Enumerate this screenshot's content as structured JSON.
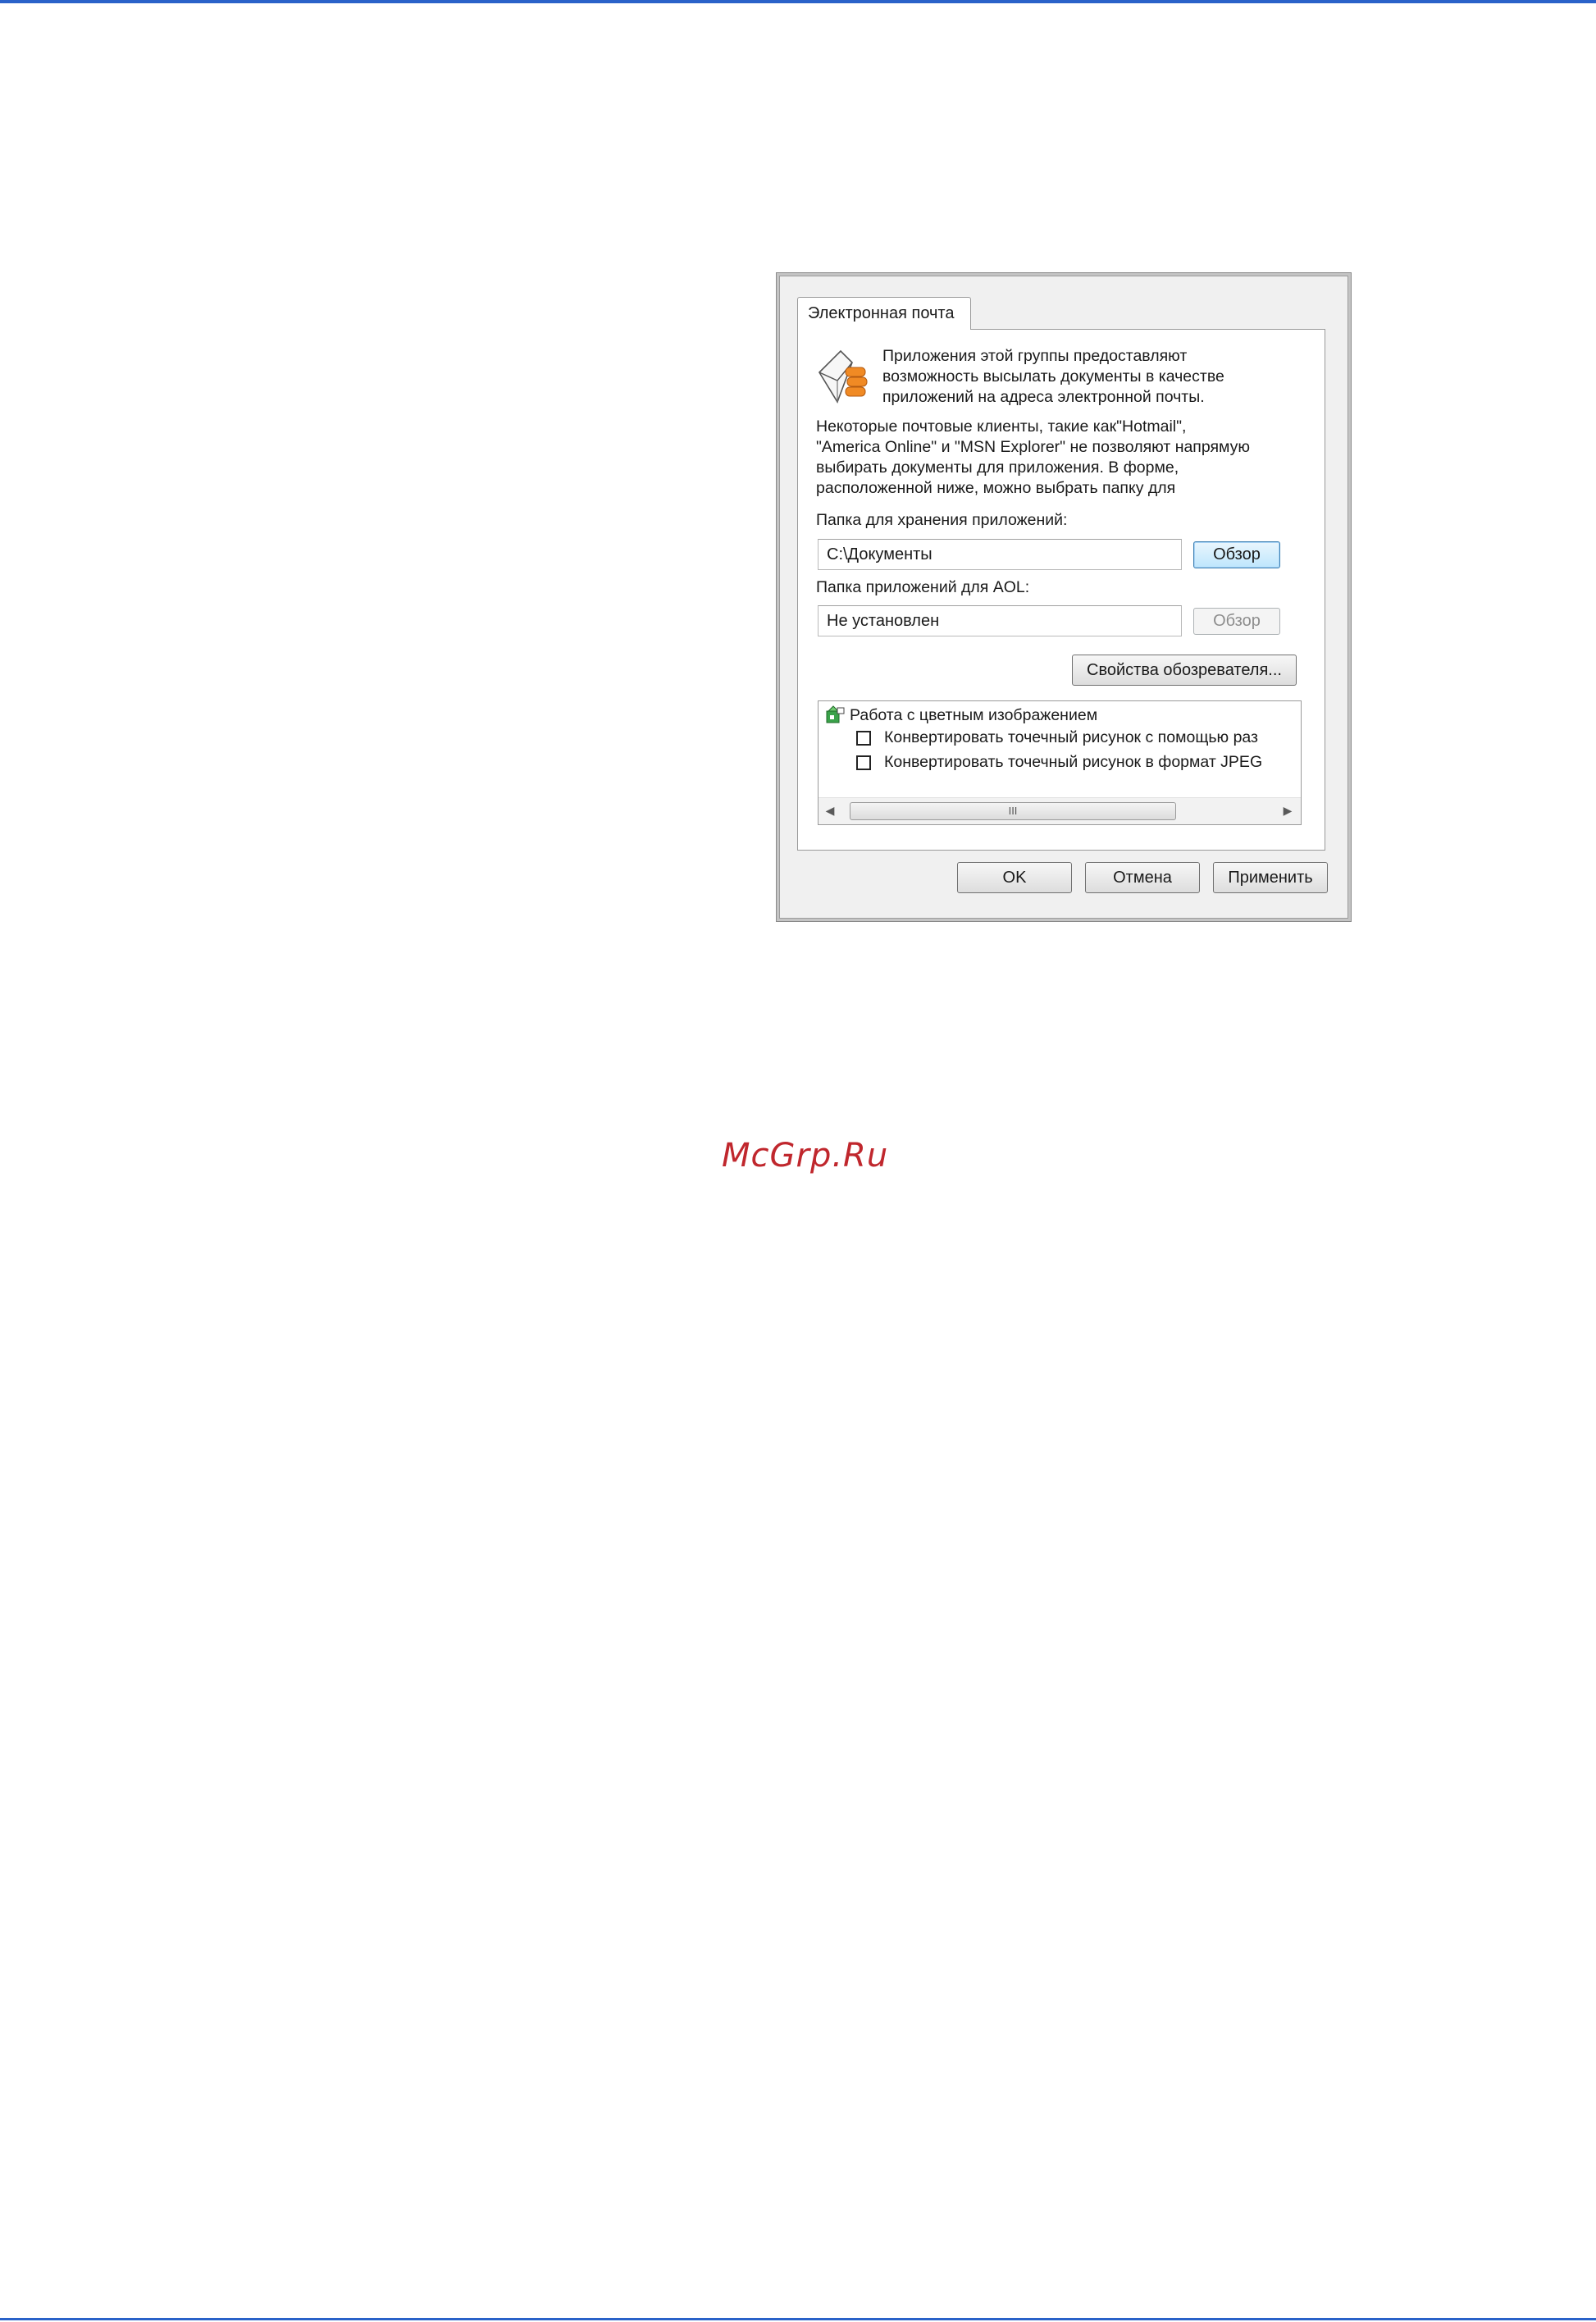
{
  "dialog": {
    "tab_label": "Электронная почта",
    "intro_lines": [
      "Приложения этой группы предоставляют",
      "возможность высылать документы в качестве",
      "приложений на адреса электронной почты."
    ],
    "note_lines": [
      "Некоторые почтовые клиенты, такие как\"Hotmail\",",
      "\"America Online\" и \"MSN Explorer\" не позволяют напрямую",
      "выбирать документы для приложения. В форме,",
      "расположенной ниже, можно выбрать папку для"
    ],
    "attachments_folder": {
      "label": "Папка для хранения приложений:",
      "value": "C:\\Документы",
      "browse_label": "Обзор"
    },
    "aol_folder": {
      "label": "Папка приложений для AOL:",
      "value": "Не установлен",
      "browse_label": "Обзор"
    },
    "browser_properties_label": "Свойства обозревателя...",
    "tree": {
      "group_label": "Работа с цветным изображением",
      "items": [
        {
          "label": "Конвертировать точечный рисунок с помощью раз",
          "checked": false
        },
        {
          "label": "Конвертировать точечный рисунок в формат JPEG",
          "checked": false
        }
      ],
      "scroll_thumb_label": "III"
    },
    "buttons": {
      "ok": "OK",
      "cancel": "Отмена",
      "apply": "Применить"
    }
  },
  "watermark": "McGrp.Ru",
  "colors": {
    "page_rule": "#2a62c9",
    "watermark": "#c0272d",
    "dialog_bg": "#f0f0f0"
  }
}
